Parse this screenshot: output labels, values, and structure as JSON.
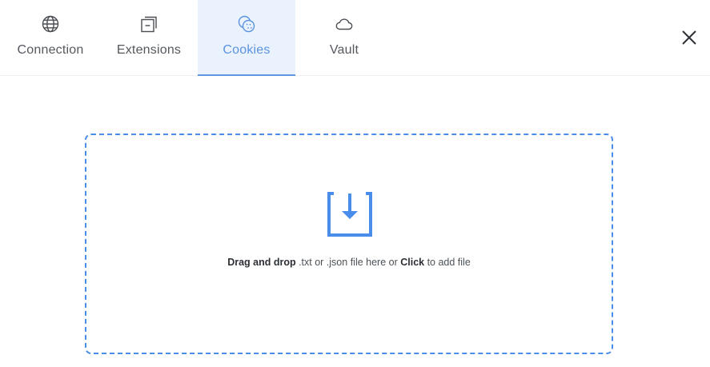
{
  "tabs": [
    {
      "id": "connection",
      "label": "Connection",
      "icon": "globe-icon",
      "active": false
    },
    {
      "id": "extensions",
      "label": "Extensions",
      "icon": "extensions-icon",
      "active": false
    },
    {
      "id": "cookies",
      "label": "Cookies",
      "icon": "cookie-icon",
      "active": true
    },
    {
      "id": "vault",
      "label": "Vault",
      "icon": "cloud-icon",
      "active": false
    }
  ],
  "close": {
    "icon": "close-icon"
  },
  "dropzone": {
    "icon": "download-tray-icon",
    "text_bold_1": "Drag and drop",
    "text_mid": " .txt or .json file here or ",
    "text_bold_2": "Click",
    "text_end": " to add file"
  },
  "colors": {
    "accent": "#4a8cea",
    "active_tab_bg": "#eaf2fd",
    "text": "#55595e"
  }
}
